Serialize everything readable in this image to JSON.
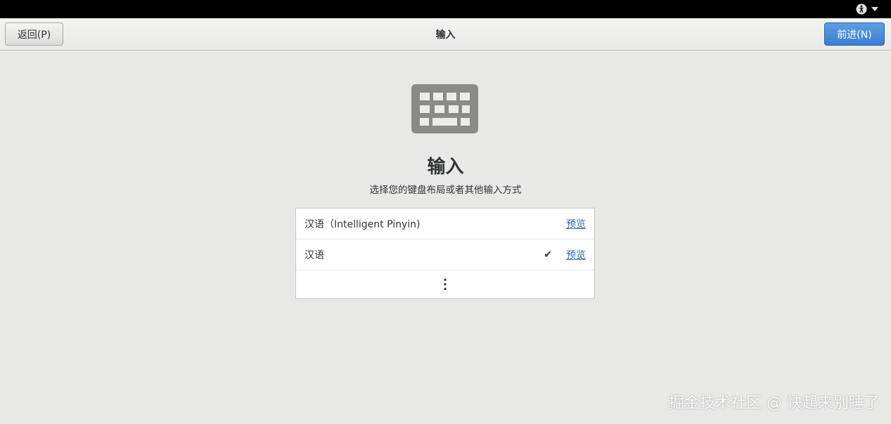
{
  "header": {
    "title": "输入",
    "back_label": "返回(P)",
    "next_label": "前进(N)"
  },
  "topbar": {
    "accessibility_icon": "accessibility-icon",
    "menu_icon": "chevron-down-icon"
  },
  "main": {
    "icon": "keyboard-icon",
    "title": "输入",
    "subtitle": "选择您的键盘布局或者其他输入方式",
    "input_sources": [
      {
        "label": "汉语（Intelligent Pinyin)",
        "selected": false,
        "preview_label": "预览"
      },
      {
        "label": "汉语",
        "selected": true,
        "check": "✔",
        "preview_label": "预览"
      }
    ],
    "more_icon": "more-vertical-icon"
  },
  "watermark": "掘金技术社区 @ 快起来别睡了",
  "colors": {
    "accent": "#3a80d3",
    "link": "#2a6bb8",
    "background": "#e8e8e7"
  }
}
